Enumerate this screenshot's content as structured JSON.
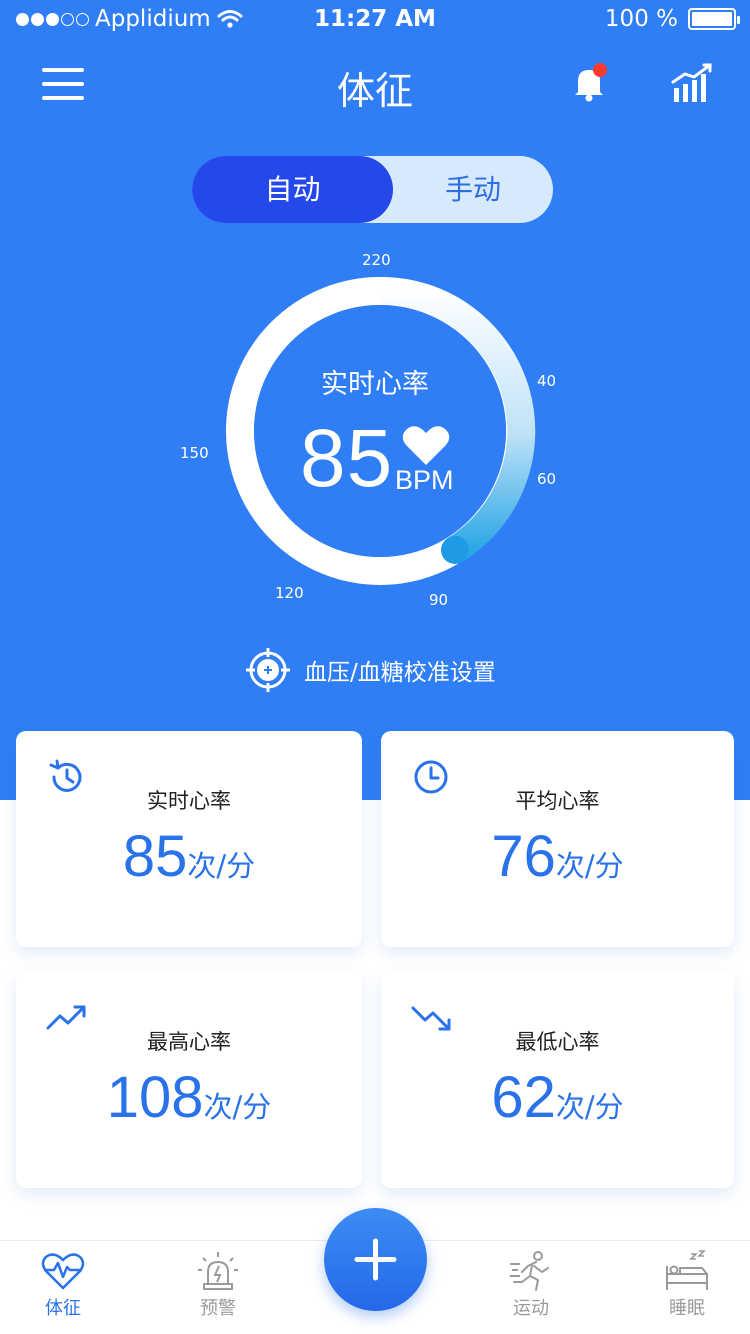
{
  "status_bar": {
    "carrier": "Applidium",
    "time": "11:27 AM",
    "battery": "100 %"
  },
  "header": {
    "title": "体征"
  },
  "mode_toggle": {
    "auto": "自动",
    "manual": "手动",
    "selected": "自动"
  },
  "gauge": {
    "label": "实时心率",
    "value": "85",
    "unit": "BPM",
    "ticks": {
      "top": "220",
      "upper_right": "40",
      "right": "60",
      "bottom_right": "90",
      "bottom_left": "120",
      "left": "150"
    }
  },
  "calibration": {
    "label": "血压/血糖校准设置"
  },
  "cards": [
    {
      "title": "实时心率",
      "value": "85",
      "unit": "次/分",
      "icon": "history-icon"
    },
    {
      "title": "平均心率",
      "value": "76",
      "unit": "次/分",
      "icon": "clock-icon"
    },
    {
      "title": "最高心率",
      "value": "108",
      "unit": "次/分",
      "icon": "trend-up-icon"
    },
    {
      "title": "最低心率",
      "value": "62",
      "unit": "次/分",
      "icon": "trend-down-icon"
    }
  ],
  "tabs": [
    {
      "label": "体征",
      "icon": "heartbeat-icon",
      "active": true
    },
    {
      "label": "预警",
      "icon": "alarm-light-icon",
      "active": false
    },
    {
      "label": "运动",
      "icon": "runner-icon",
      "active": false
    },
    {
      "label": "睡眠",
      "icon": "sleep-bed-icon",
      "active": false
    }
  ],
  "colors": {
    "primary": "#2f7ef5",
    "toggle_active": "#2448ea",
    "accent_text": "#2a72ea",
    "notification_dot": "#ff3b30"
  }
}
